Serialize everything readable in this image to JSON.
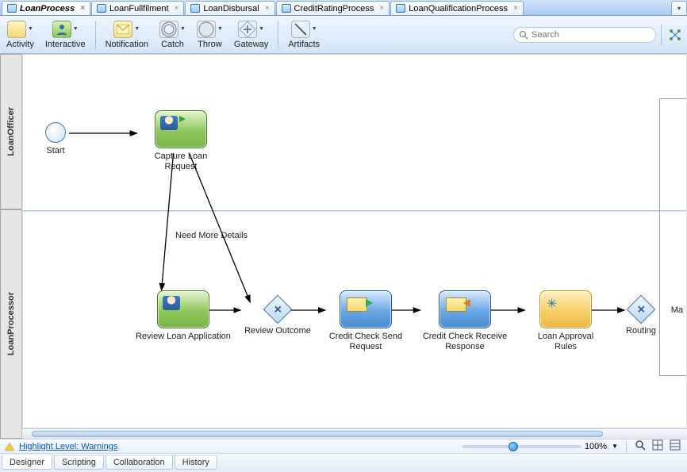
{
  "tabs": [
    {
      "label": "LoanProcess",
      "active": true
    },
    {
      "label": "LoanFullfilment",
      "active": false
    },
    {
      "label": "LoanDisbursal",
      "active": false
    },
    {
      "label": "CreditRatingProcess",
      "active": false
    },
    {
      "label": "LoanQualificationProcess",
      "active": false
    }
  ],
  "toolbar": {
    "activity": "Activity",
    "interactive": "Interactive",
    "notification": "Notification",
    "catch": "Catch",
    "throw": "Throw",
    "gateway": "Gateway",
    "artifacts": "Artifacts"
  },
  "search": {
    "placeholder": "Search"
  },
  "lanes": {
    "top": "LoanOfficer",
    "bottom": "LoanProcessor"
  },
  "nodes": {
    "start": "Start",
    "capture": "Capture Loan Request",
    "need_more": "Need More Details",
    "review_app": "Review Loan Application",
    "review_outcome": "Review Outcome",
    "credit_send": "Credit Check Send Request",
    "credit_recv": "Credit Check Receive Response",
    "approval": "Loan Approval Rules",
    "routing": "Routing",
    "ma_frag": "Ma"
  },
  "status": {
    "highlight": "Highlight Level: Warnings",
    "zoom_pct": "100%"
  },
  "bottom_tabs": {
    "designer": "Designer",
    "scripting": "Scripting",
    "collaboration": "Collaboration",
    "history": "History"
  }
}
